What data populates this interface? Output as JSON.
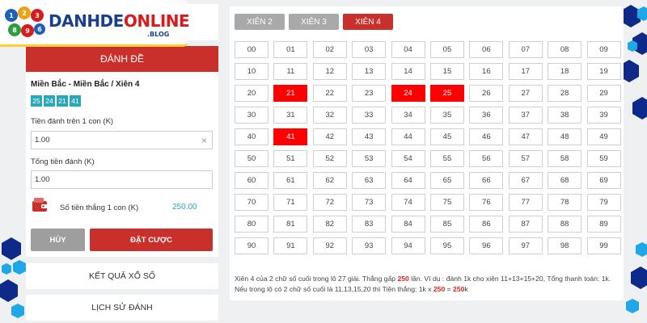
{
  "brand": {
    "name_part1": "DANHDE",
    "name_part2": "ONLINE",
    "suffix": ".BLOG",
    "ball_digits": [
      "1",
      "2",
      "3",
      "8",
      "9",
      "6"
    ],
    "colors": {
      "primary": "#c9302c",
      "teal": "#2aa8b8",
      "navy": "#1b3f8f",
      "gold": "#ffcc33"
    }
  },
  "left": {
    "header": "ĐÁNH ĐỀ",
    "bet_title": "Miền Bắc - Miền Bắc / Xiên 4",
    "selected_chips": [
      "25",
      "24",
      "21",
      "41"
    ],
    "stake_label": "Tiền đánh trên 1 con (K)",
    "stake_value": "1.00",
    "total_label": "Tổng tiền đánh (K)",
    "total_value": "1.00",
    "win_label": "Số tiền thắng 1 con (K)",
    "win_value": "250.00",
    "cancel_label": "HỦY",
    "bet_label": "ĐẶT CƯỢC",
    "results_link": "KẾT QUẢ XỔ SỐ",
    "history_link": "LỊCH SỬ ĐÁNH"
  },
  "tabs": [
    {
      "label": "XIÊN 2",
      "active": false
    },
    {
      "label": "XIÊN 3",
      "active": false
    },
    {
      "label": "XIÊN 4",
      "active": true
    }
  ],
  "numbers": {
    "selected": [
      "21",
      "24",
      "25",
      "41"
    ]
  },
  "info": {
    "p1": "Xiên 4 của 2 chữ số cuối trong lô 27 giải. Thắng gấp ",
    "mult": "250",
    "p2": " lần. Ví dụ : đánh 1k cho xiên 11+13+15+20, Tổng thanh toán: 1k. Nếu trong lô có 2 chữ số cuối là 11,13,15,20 thì Tiền thắng: 1k x ",
    "mult2": "250",
    "p3": " = ",
    "win": "250",
    "p4": "k"
  }
}
